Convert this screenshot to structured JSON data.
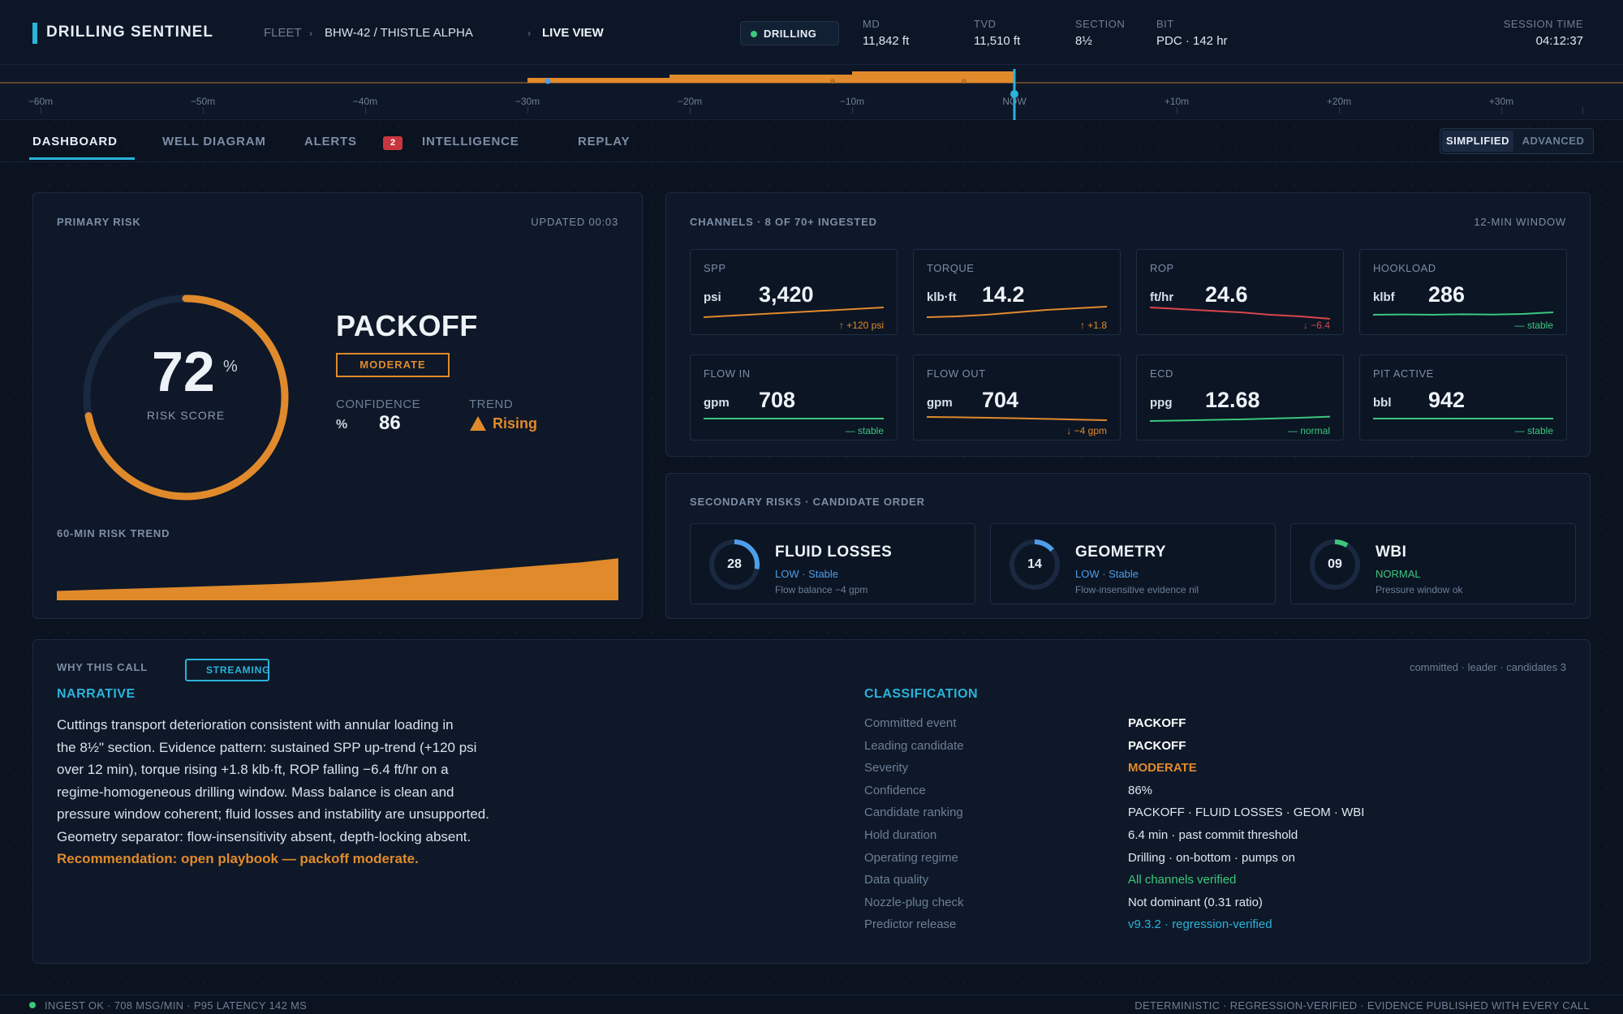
{
  "header": {
    "app_title": "DRILLING SENTINEL",
    "fleet_label": "FLEET",
    "well": "BHW-42 / THISTLE ALPHA",
    "view": "LIVE VIEW",
    "status": "DRILLING",
    "metrics": [
      {
        "key": "MD",
        "value": "11,842 ft"
      },
      {
        "key": "TVD",
        "value": "11,510 ft"
      },
      {
        "key": "SECTION",
        "value": "8½"
      },
      {
        "key": "BIT",
        "value": "PDC · 142 hr"
      }
    ],
    "session_label": "SESSION TIME",
    "session_time": "04:12:37"
  },
  "timeline": {
    "ticks": [
      "−60m",
      "−50m",
      "−40m",
      "−30m",
      "−20m",
      "−10m",
      "NOW",
      "+10m",
      "+20m",
      "+30m"
    ]
  },
  "tabs": {
    "items": [
      "DASHBOARD",
      "WELL DIAGRAM",
      "ALERTS",
      "INTELLIGENCE",
      "REPLAY"
    ],
    "alerts_count": "2",
    "mode_simplified": "SIMPLIFIED",
    "mode_advanced": "ADVANCED"
  },
  "primary_risk": {
    "label": "PRIMARY RISK",
    "updated": "UPDATED 00:03",
    "score": "72",
    "score_fraction": 0.72,
    "score_unit": "%",
    "score_label": "RISK SCORE",
    "event": "PACKOFF",
    "severity": "MODERATE",
    "confidence_label": "CONFIDENCE",
    "confidence_unit": "%",
    "confidence": "86",
    "trend_label": "TREND",
    "trend": "Rising",
    "trend_section": "60-MIN RISK TREND",
    "trend_values": [
      0.16,
      0.18,
      0.2,
      0.22,
      0.24,
      0.26,
      0.28,
      0.31,
      0.35,
      0.4,
      0.45,
      0.5,
      0.55,
      0.6,
      0.65,
      0.72
    ]
  },
  "channels": {
    "title": "CHANNELS · 8 OF 70+ INGESTED",
    "window": "12-MIN WINDOW",
    "items": [
      {
        "name": "SPP",
        "unit": "psi",
        "value": "3,420",
        "delta": "↑ +120 psi",
        "color": "#e08a2c",
        "spark": [
          0.25,
          0.35,
          0.45,
          0.55,
          0.65,
          0.75,
          0.85
        ]
      },
      {
        "name": "TORQUE",
        "unit": "klb·ft",
        "value": "14.2",
        "delta": "↑ +1.8",
        "color": "#e08a2c",
        "spark": [
          0.25,
          0.3,
          0.4,
          0.55,
          0.7,
          0.8,
          0.9
        ]
      },
      {
        "name": "ROP",
        "unit": "ft/hr",
        "value": "24.6",
        "delta": "↓ −6.4",
        "color": "#d9454a",
        "spark": [
          0.85,
          0.75,
          0.65,
          0.55,
          0.4,
          0.3,
          0.15
        ]
      },
      {
        "name": "HOOKLOAD",
        "unit": "klbf",
        "value": "286",
        "delta": "— stable",
        "color": "#3cc77c",
        "spark": [
          0.4,
          0.42,
          0.4,
          0.43,
          0.41,
          0.45,
          0.55
        ]
      },
      {
        "name": "FLOW IN",
        "unit": "gpm",
        "value": "708",
        "delta": "— stable",
        "color": "#3cc77c",
        "spark": [
          0.5,
          0.5,
          0.5,
          0.5,
          0.5,
          0.5,
          0.5
        ]
      },
      {
        "name": "FLOW OUT",
        "unit": "gpm",
        "value": "704",
        "delta": "↓ −4 gpm",
        "color": "#e08a2c",
        "spark": [
          0.6,
          0.58,
          0.55,
          0.52,
          0.48,
          0.44,
          0.4
        ]
      },
      {
        "name": "ECD",
        "unit": "ppg",
        "value": "12.68",
        "delta": "— normal",
        "color": "#3cc77c",
        "spark": [
          0.35,
          0.38,
          0.42,
          0.45,
          0.5,
          0.55,
          0.62
        ]
      },
      {
        "name": "PIT ACTIVE",
        "unit": "bbl",
        "value": "942",
        "delta": "— stable",
        "color": "#3cc77c",
        "spark": [
          0.5,
          0.5,
          0.5,
          0.5,
          0.5,
          0.5,
          0.5
        ]
      }
    ]
  },
  "secondary": {
    "title": "SECONDARY RISKS · CANDIDATE ORDER",
    "items": [
      {
        "value": "28",
        "fraction": 0.28,
        "name": "FLUID LOSSES",
        "status": "LOW · Stable",
        "status_color": "#4f9de8",
        "ring_color": "#4f9de8",
        "evidence": "Flow balance −4 gpm"
      },
      {
        "value": "14",
        "fraction": 0.14,
        "name": "GEOMETRY",
        "status": "LOW · Stable",
        "status_color": "#4f9de8",
        "ring_color": "#4f9de8",
        "evidence": "Flow-insensitive evidence nil"
      },
      {
        "value": "09",
        "fraction": 0.09,
        "name": "WBI",
        "status": "NORMAL",
        "status_color": "#3cc77c",
        "ring_color": "#3cc77c",
        "evidence": "Pressure window ok"
      }
    ]
  },
  "why": {
    "label": "WHY THIS CALL",
    "streaming": "STREAMING",
    "meta": "committed · leader · candidates 3",
    "narrative_title": "NARRATIVE",
    "narrative_lines": [
      "Cuttings transport deterioration consistent with annular loading in",
      "the 8½\" section. Evidence pattern: sustained SPP up-trend (+120 psi",
      "over 12 min), torque rising +1.8 klb·ft, ROP falling −6.4 ft/hr on a",
      "regime-homogeneous drilling window. Mass balance is clean and",
      "pressure window coherent; fluid losses and instability are unsupported.",
      "Geometry separator: flow-insensitivity absent, depth-locking absent."
    ],
    "recommendation": "Recommendation: open playbook — packoff moderate.",
    "classification_title": "CLASSIFICATION",
    "rows": [
      {
        "k": "Committed event",
        "v": "PACKOFF",
        "color": "#ffffff",
        "bold": true
      },
      {
        "k": "Leading candidate",
        "v": "PACKOFF",
        "color": "#ffffff",
        "bold": true
      },
      {
        "k": "Severity",
        "v": "MODERATE",
        "color": "#e08a2c",
        "bold": true
      },
      {
        "k": "Confidence",
        "v": "86%",
        "color": "#e0e7f0",
        "bold": false
      },
      {
        "k": "Candidate ranking",
        "v": "PACKOFF · FLUID LOSSES · GEOM · WBI",
        "color": "#e0e7f0",
        "bold": false
      },
      {
        "k": "Hold duration",
        "v": "6.4 min · past commit threshold",
        "color": "#e0e7f0",
        "bold": false
      },
      {
        "k": "Operating regime",
        "v": "Drilling · on-bottom · pumps on",
        "color": "#e0e7f0",
        "bold": false
      },
      {
        "k": "Data quality",
        "v": "All channels verified",
        "color": "#3cc77c",
        "bold": false
      },
      {
        "k": "Nozzle-plug check",
        "v": "Not dominant (0.31 ratio)",
        "color": "#e0e7f0",
        "bold": false
      },
      {
        "k": "Predictor release",
        "v": "v9.3.2 · regression-verified",
        "color": "#2bb3d9",
        "bold": false
      }
    ]
  },
  "footer": {
    "left": "INGEST OK · 708 MSG/MIN · P95 LATENCY 142 MS",
    "right": "DETERMINISTIC · REGRESSION-VERIFIED · EVIDENCE PUBLISHED WITH EVERY CALL"
  },
  "colors": {
    "accent": "#2bb3d9",
    "warning": "#e08a2c",
    "ok": "#3cc77c",
    "danger": "#d9454a"
  }
}
